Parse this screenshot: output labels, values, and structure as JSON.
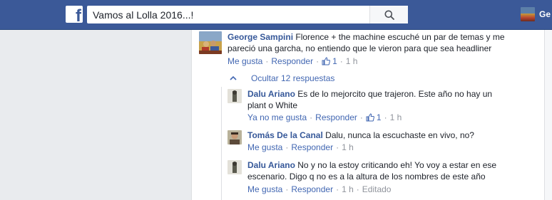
{
  "header": {
    "search_value": "Vamos al Lolla 2016...!",
    "search_icon": "search-icon",
    "logo": "facebook-logo",
    "profile_name": "Ge"
  },
  "colors": {
    "brand": "#3b5998",
    "link": "#4267b2",
    "author": "#365899",
    "meta": "#90949c"
  },
  "comments": [
    {
      "author": "George Sampini",
      "text": "Florence + the machine escuché un par de temas y me pareció una garcha, no entiendo que le vieron para que sea headliner",
      "like_label": "Me gusta",
      "reply_label": "Responder",
      "likes": "1",
      "time": "1 h"
    }
  ],
  "replies_toggle": "Ocultar 12 respuestas",
  "replies": [
    {
      "author": "Dalu Ariano",
      "text": "Es de lo mejorcito que trajeron. Este año no hay un plant o White",
      "like_label": "Ya no me gusta",
      "reply_label": "Responder",
      "likes": "1",
      "time": "1 h"
    },
    {
      "author": "Tomás De la Canal",
      "text": "Dalu, nunca la escuchaste en vivo, no?",
      "like_label": "Me gusta",
      "reply_label": "Responder",
      "time": "1 h"
    },
    {
      "author": "Dalu Ariano",
      "text": "No y no la estoy criticando eh! Yo voy a estar en ese escenario. Digo q no es a la altura de los nombres de este año",
      "like_label": "Me gusta",
      "reply_label": "Responder",
      "time": "1 h",
      "edited": "Editado"
    }
  ]
}
